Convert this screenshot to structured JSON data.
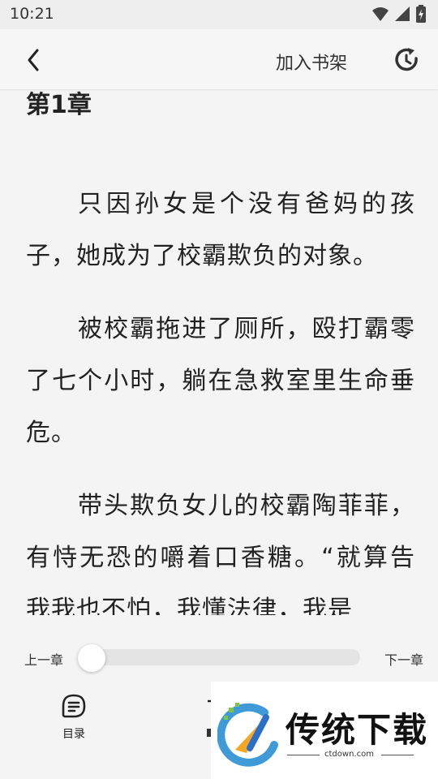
{
  "status_bar": {
    "time": "10:21"
  },
  "top_bar": {
    "add_to_shelf": "加入书架"
  },
  "chapter": {
    "title": "第1章",
    "paragraphs": [
      "只因孙女是个没有爸妈的孩子，她成为了校霸欺负的对象。",
      "被校霸拖进了厕所，殴打霸零了七个小时，躺在急救室里生命垂危。",
      "带头欺负女儿的校霸陶菲菲，有恃无恐的嚼着口香糖。“就算告我我也不怕，我懂法律，我是"
    ]
  },
  "reader_controls": {
    "prev_chapter": "上一章",
    "next_chapter": "下一章",
    "progress": 0.0,
    "toc_label": "目录"
  },
  "watermark": {
    "text": "传统下载",
    "url": "ctdown.com"
  },
  "colors": {
    "background": "#f4f4f4",
    "text": "#222222",
    "track": "#e4e4e4"
  }
}
